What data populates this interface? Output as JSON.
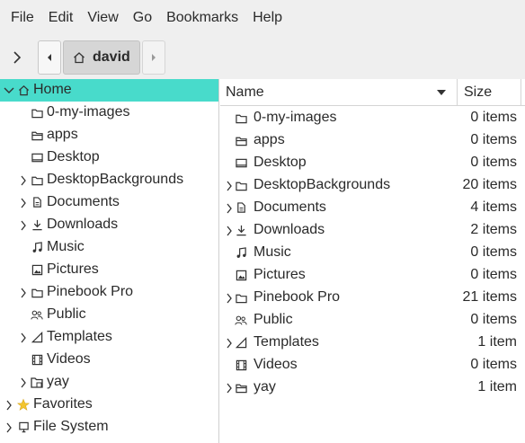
{
  "menu": [
    "File",
    "Edit",
    "View",
    "Go",
    "Bookmarks",
    "Help"
  ],
  "location": {
    "current": "david"
  },
  "sidebar": {
    "home": "Home",
    "items": [
      {
        "label": "0-my-images",
        "icon": "folder-icon",
        "expandable": false
      },
      {
        "label": "apps",
        "icon": "folder-open-icon",
        "expandable": false
      },
      {
        "label": "Desktop",
        "icon": "desktop-icon",
        "expandable": false
      },
      {
        "label": "DesktopBackgrounds",
        "icon": "folder-icon",
        "expandable": true
      },
      {
        "label": "Documents",
        "icon": "documents-icon",
        "expandable": true
      },
      {
        "label": "Downloads",
        "icon": "download-icon",
        "expandable": true
      },
      {
        "label": "Music",
        "icon": "music-icon",
        "expandable": false
      },
      {
        "label": "Pictures",
        "icon": "pictures-icon",
        "expandable": false
      },
      {
        "label": "Pinebook Pro",
        "icon": "folder-icon",
        "expandable": true
      },
      {
        "label": "Public",
        "icon": "public-icon",
        "expandable": false
      },
      {
        "label": "Templates",
        "icon": "templates-icon",
        "expandable": true
      },
      {
        "label": "Videos",
        "icon": "videos-icon",
        "expandable": false
      },
      {
        "label": "yay",
        "icon": "folder-special-icon",
        "expandable": true
      }
    ],
    "favorites": "Favorites",
    "filesystem": "File System"
  },
  "columns": {
    "name": "Name",
    "size": "Size"
  },
  "files": [
    {
      "name": "0-my-images",
      "size": "0 items",
      "icon": "folder-icon",
      "expandable": false
    },
    {
      "name": "apps",
      "size": "0 items",
      "icon": "folder-open-icon",
      "expandable": false
    },
    {
      "name": "Desktop",
      "size": "0 items",
      "icon": "desktop-icon",
      "expandable": false
    },
    {
      "name": "DesktopBackgrounds",
      "size": "20 items",
      "icon": "folder-icon",
      "expandable": true
    },
    {
      "name": "Documents",
      "size": "4 items",
      "icon": "documents-icon",
      "expandable": true
    },
    {
      "name": "Downloads",
      "size": "2 items",
      "icon": "download-icon",
      "expandable": true
    },
    {
      "name": "Music",
      "size": "0 items",
      "icon": "music-icon",
      "expandable": false
    },
    {
      "name": "Pictures",
      "size": "0 items",
      "icon": "pictures-icon",
      "expandable": false
    },
    {
      "name": "Pinebook Pro",
      "size": "21 items",
      "icon": "folder-icon",
      "expandable": true
    },
    {
      "name": "Public",
      "size": "0 items",
      "icon": "public-icon",
      "expandable": false
    },
    {
      "name": "Templates",
      "size": "1 item",
      "icon": "templates-icon",
      "expandable": true
    },
    {
      "name": "Videos",
      "size": "0 items",
      "icon": "videos-icon",
      "expandable": false
    },
    {
      "name": "yay",
      "size": "1 item",
      "icon": "folder-open-icon",
      "expandable": true
    }
  ],
  "colors": {
    "selection": "#48dbcb",
    "chrome": "#efefef"
  }
}
